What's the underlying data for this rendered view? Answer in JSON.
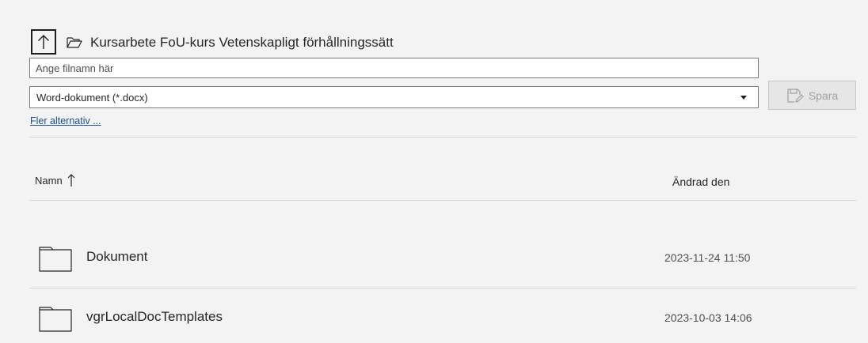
{
  "header": {
    "folder_path": "Kursarbete FoU-kurs Vetenskapligt förhållningssätt"
  },
  "form": {
    "filename_placeholder": "Ange filnamn här",
    "filename_value": "",
    "format_selected": "Word-dokument (*.docx)",
    "save_label": "Spara",
    "more_options": "Fler alternativ ..."
  },
  "list": {
    "columns": {
      "name": "Namn",
      "modified": "Ändrad den"
    },
    "sort": "name-ascending",
    "rows": [
      {
        "name": "Dokument",
        "modified": "2023-11-24 11:50",
        "icon": "folder-icon"
      },
      {
        "name": "vgrLocalDocTemplates",
        "modified": "2023-10-03 14:06",
        "icon": "folder-icon"
      }
    ]
  },
  "colors": {
    "background": "#f3f3f3",
    "link": "#1a4f8c",
    "disabled_text": "#a0a0a0"
  }
}
